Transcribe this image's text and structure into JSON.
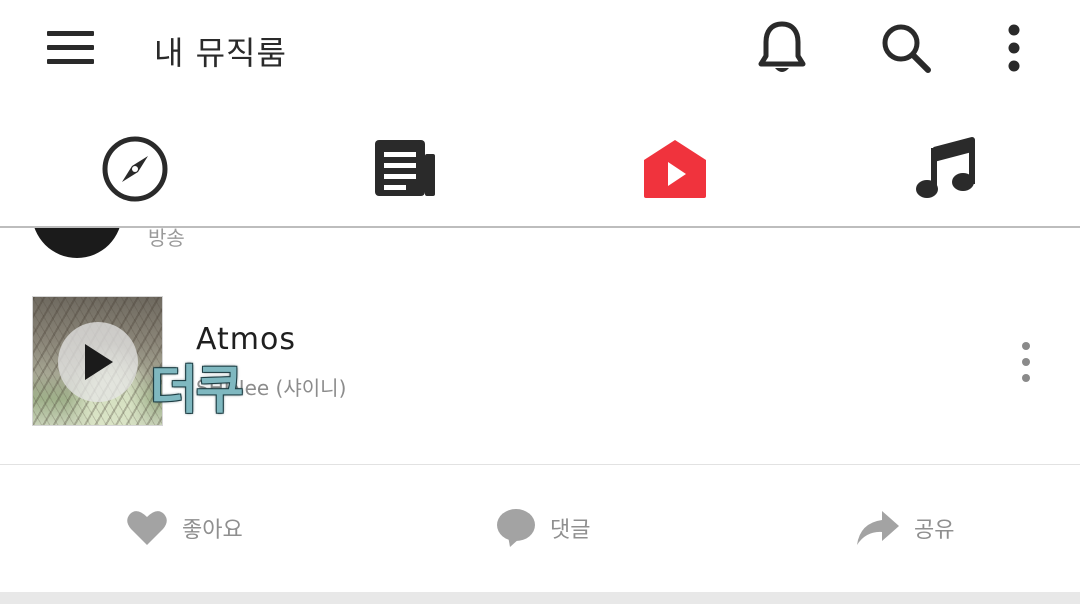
{
  "header": {
    "title": "내 뮤직룸",
    "icons": [
      "menu-icon",
      "bell-icon",
      "search-icon",
      "more-vert-icon"
    ]
  },
  "tabs": [
    {
      "name": "explore",
      "icon": "compass-icon",
      "active": false
    },
    {
      "name": "news",
      "icon": "newspaper-icon",
      "active": false
    },
    {
      "name": "my-music-room",
      "icon": "home-play-icon",
      "active": true
    },
    {
      "name": "music",
      "icon": "music-note-icon",
      "active": false
    }
  ],
  "colors": {
    "accent": "#f0333d",
    "icon_dark": "#2a2a2a",
    "muted": "#9a9a9a",
    "watermark": "#7fb8c0"
  },
  "feed": {
    "previous_item_text": "방송",
    "track": {
      "title": "Atmos",
      "artist": "SHINee (샤이니)",
      "watermark_text": "더쿠"
    },
    "actions": {
      "like": "좋아요",
      "comment": "댓글",
      "share": "공유"
    }
  }
}
